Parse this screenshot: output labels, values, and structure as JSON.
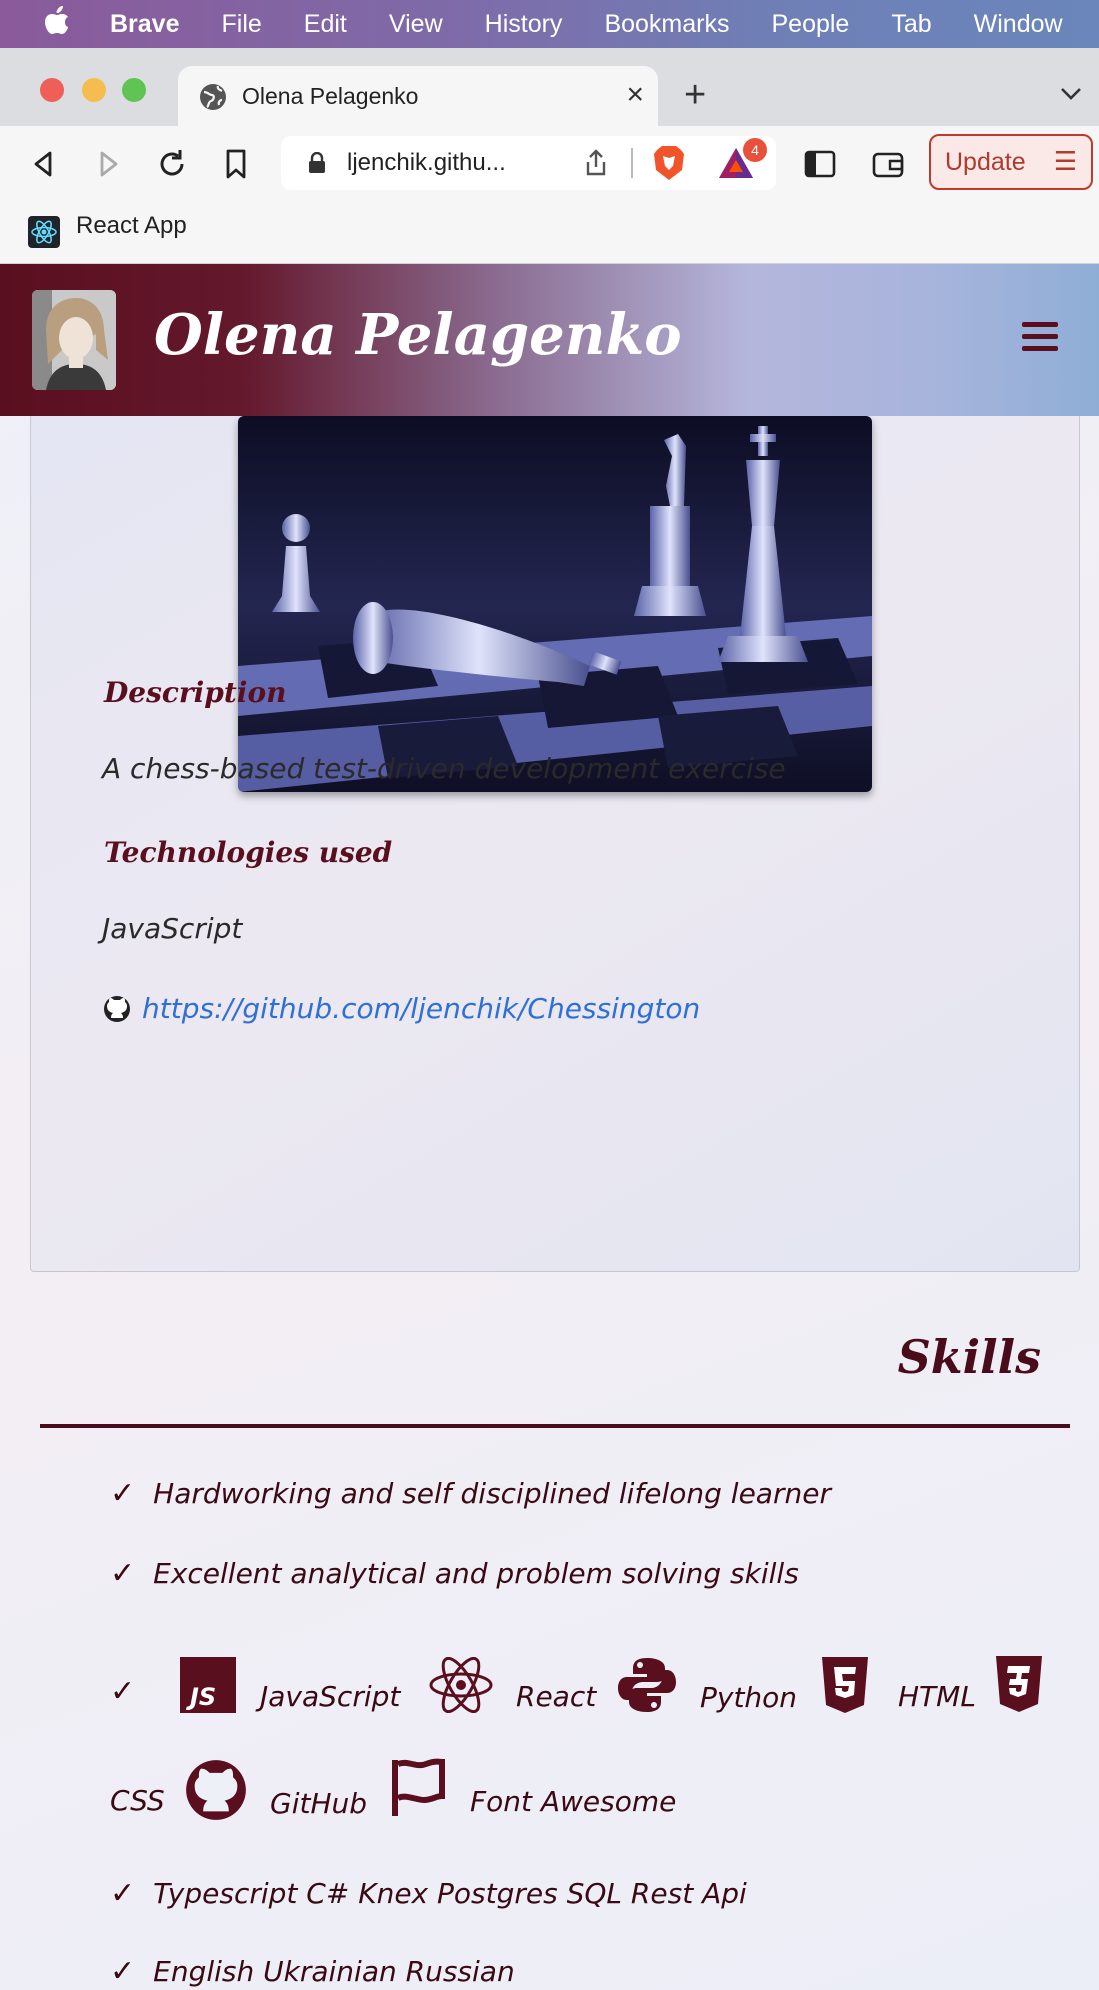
{
  "menubar": {
    "app": "Brave",
    "items": [
      "File",
      "Edit",
      "View",
      "History",
      "Bookmarks",
      "People",
      "Tab",
      "Window"
    ]
  },
  "tab": {
    "title": "Olena Pelagenko"
  },
  "toolbar": {
    "url": "ljenchik.githu...",
    "update_label": "Update",
    "bat_badge": "4"
  },
  "bookmarks": {
    "items": [
      "React App"
    ]
  },
  "site": {
    "title": "Olena Pelagenko"
  },
  "project": {
    "description_heading": "Description",
    "description": "A chess-based test-driven development exercise",
    "tech_heading": "Technologies used",
    "tech": "JavaScript",
    "repo_url": "https://github.com/ljenchik/Chessington"
  },
  "skills": {
    "title": "Skills",
    "lines": [
      "Hardworking and self disciplined lifelong learner",
      "Excellent analytical and problem solving skills"
    ],
    "tech": [
      "JavaScript",
      "React",
      "Python",
      "HTML",
      "CSS",
      "GitHub",
      "Font Awesome"
    ],
    "more_lines": [
      "Typescript C# Knex Postgres SQL Rest Api",
      "English Ukrainian Russian"
    ]
  }
}
